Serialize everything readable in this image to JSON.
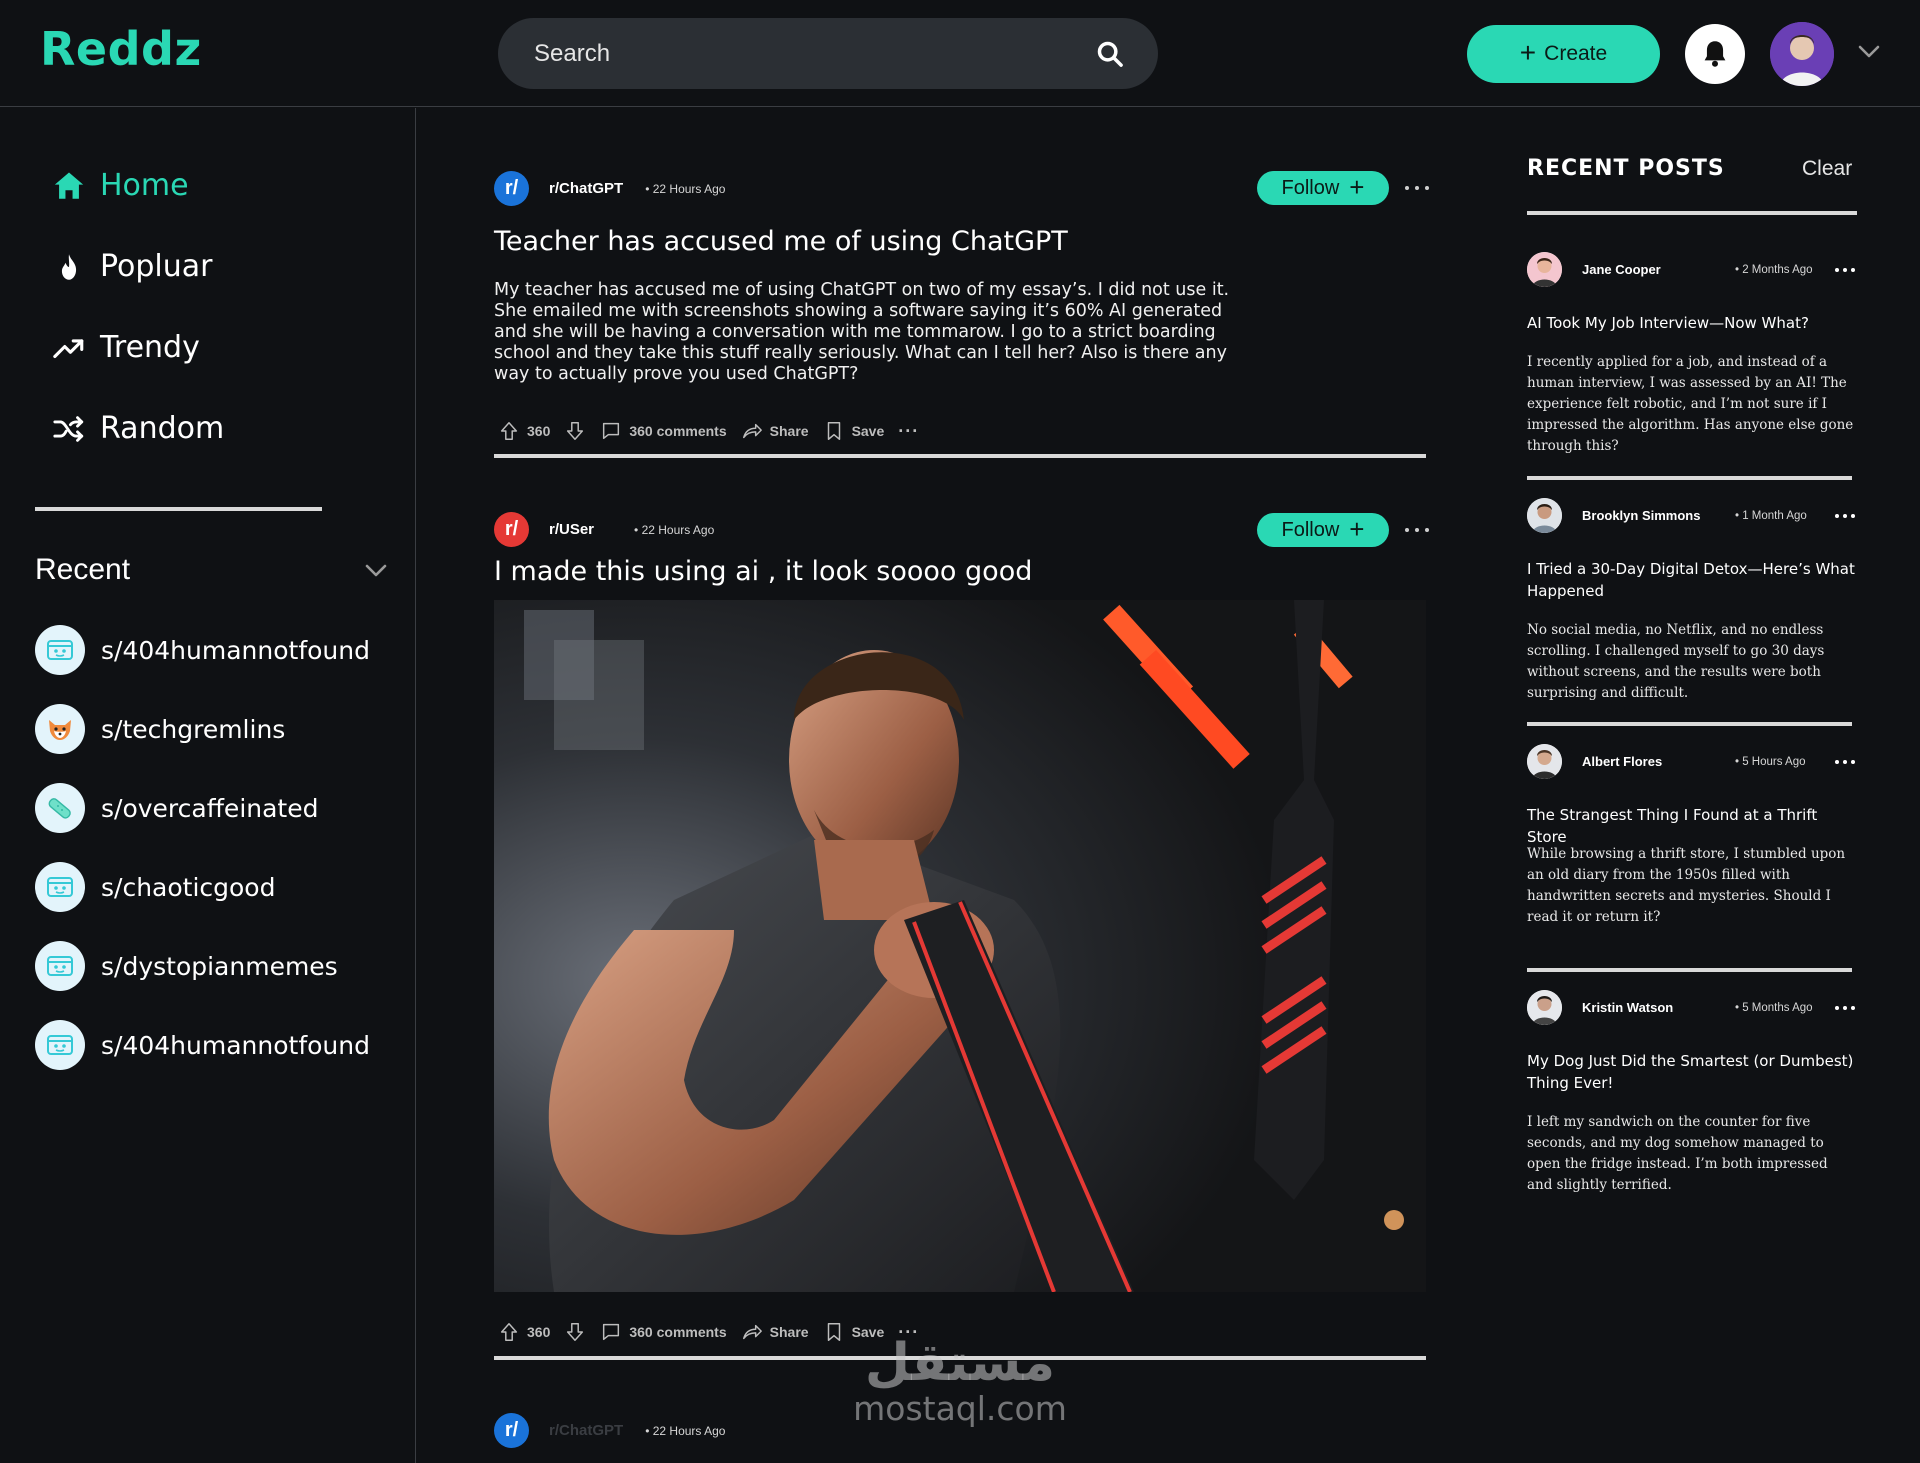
{
  "app": {
    "logo": "Reddz"
  },
  "header": {
    "search_placeholder": "Search",
    "create_label": "Create"
  },
  "sidebar": {
    "nav": [
      {
        "label": "Home",
        "icon": "home-icon",
        "active": true
      },
      {
        "label": "Popluar",
        "icon": "flame-icon"
      },
      {
        "label": "Trendy",
        "icon": "trending-up-icon"
      },
      {
        "label": "Random",
        "icon": "shuffle-icon"
      }
    ],
    "recent_title": "Recent",
    "communities": [
      {
        "name": "s/404humannotfound",
        "icon": "robot-icon"
      },
      {
        "name": "s/techgremlins",
        "icon": "fox-icon"
      },
      {
        "name": "s/overcaffeinated",
        "icon": "bandage-icon"
      },
      {
        "name": "s/chaoticgood",
        "icon": "robot-icon"
      },
      {
        "name": "s/dystopianmemes",
        "icon": "robot-icon"
      },
      {
        "name": "s/404humannotfound",
        "icon": "robot-icon"
      }
    ]
  },
  "feed": {
    "posts": [
      {
        "subreddit": "r/ChatGPT",
        "time": "• 22 Hours Ago",
        "follow_label": "Follow",
        "title": "Teacher has accused me of using ChatGPT",
        "body": "My teacher has accused me of using ChatGPT on two of my essay’s. I did not use it. She emailed me with screenshots showing a software saying it’s 60% AI generated and she will be having a conversation with me tommarow. I go to a strict boarding school and they take this stuff really seriously. What can I tell her? Also is there any way to actually prove you used ChatGPT?",
        "votes": "360",
        "comments": "360 comments",
        "share": "Share",
        "save": "Save",
        "logo_color": "#1a73d9"
      },
      {
        "subreddit": "r/USer",
        "time": "• 22 Hours Ago",
        "follow_label": "Follow",
        "title": "I made this using ai , it look soooo good",
        "votes": "360",
        "comments": "360 comments",
        "share": "Share",
        "save": "Save",
        "logo_color": "#e53935"
      },
      {
        "subreddit": "r/ChatGPT",
        "time": "• 22 Hours Ago",
        "logo_color": "#1a73d9"
      }
    ]
  },
  "recent_posts": {
    "title": "RECENT POSTS",
    "clear_label": "Clear",
    "items": [
      {
        "author": "Jane Cooper",
        "time": "• 2 Months Ago",
        "title": "AI Took My Job Interview—Now What?",
        "body": "I recently applied for a job, and instead of a human interview, I was assessed by an AI! The experience felt robotic, and I’m not sure if I impressed the algorithm. Has anyone else gone through this?"
      },
      {
        "author": "Brooklyn Simmons",
        "time": "• 1 Month Ago",
        "title": "I Tried a 30-Day Digital Detox—Here’s What Happened",
        "body": "No social media, no Netflix, and no endless scrolling. I challenged myself to go 30 days without screens, and the results were both surprising and difficult."
      },
      {
        "author": "Albert Flores",
        "time": "• 5 Hours Ago",
        "title": "The Strangest Thing I Found at a Thrift Store",
        "body": "While browsing a thrift store, I stumbled upon an old diary from the 1950s filled with handwritten secrets and mysteries. Should I read it or return it?"
      },
      {
        "author": "Kristin Watson",
        "time": "• 5 Months Ago",
        "title": "My Dog Just Did the Smartest (or Dumbest) Thing Ever!",
        "body": "I left my sandwich on the counter for five seconds, and my dog somehow managed to open the fridge instead. I’m both impressed and slightly terrified."
      }
    ]
  },
  "watermark": {
    "arabic": "مستقل",
    "latin": "mostaql.com"
  },
  "colors": {
    "accent": "#2ad8b4",
    "background": "#0f1114",
    "search_bg": "#2b2f34"
  }
}
